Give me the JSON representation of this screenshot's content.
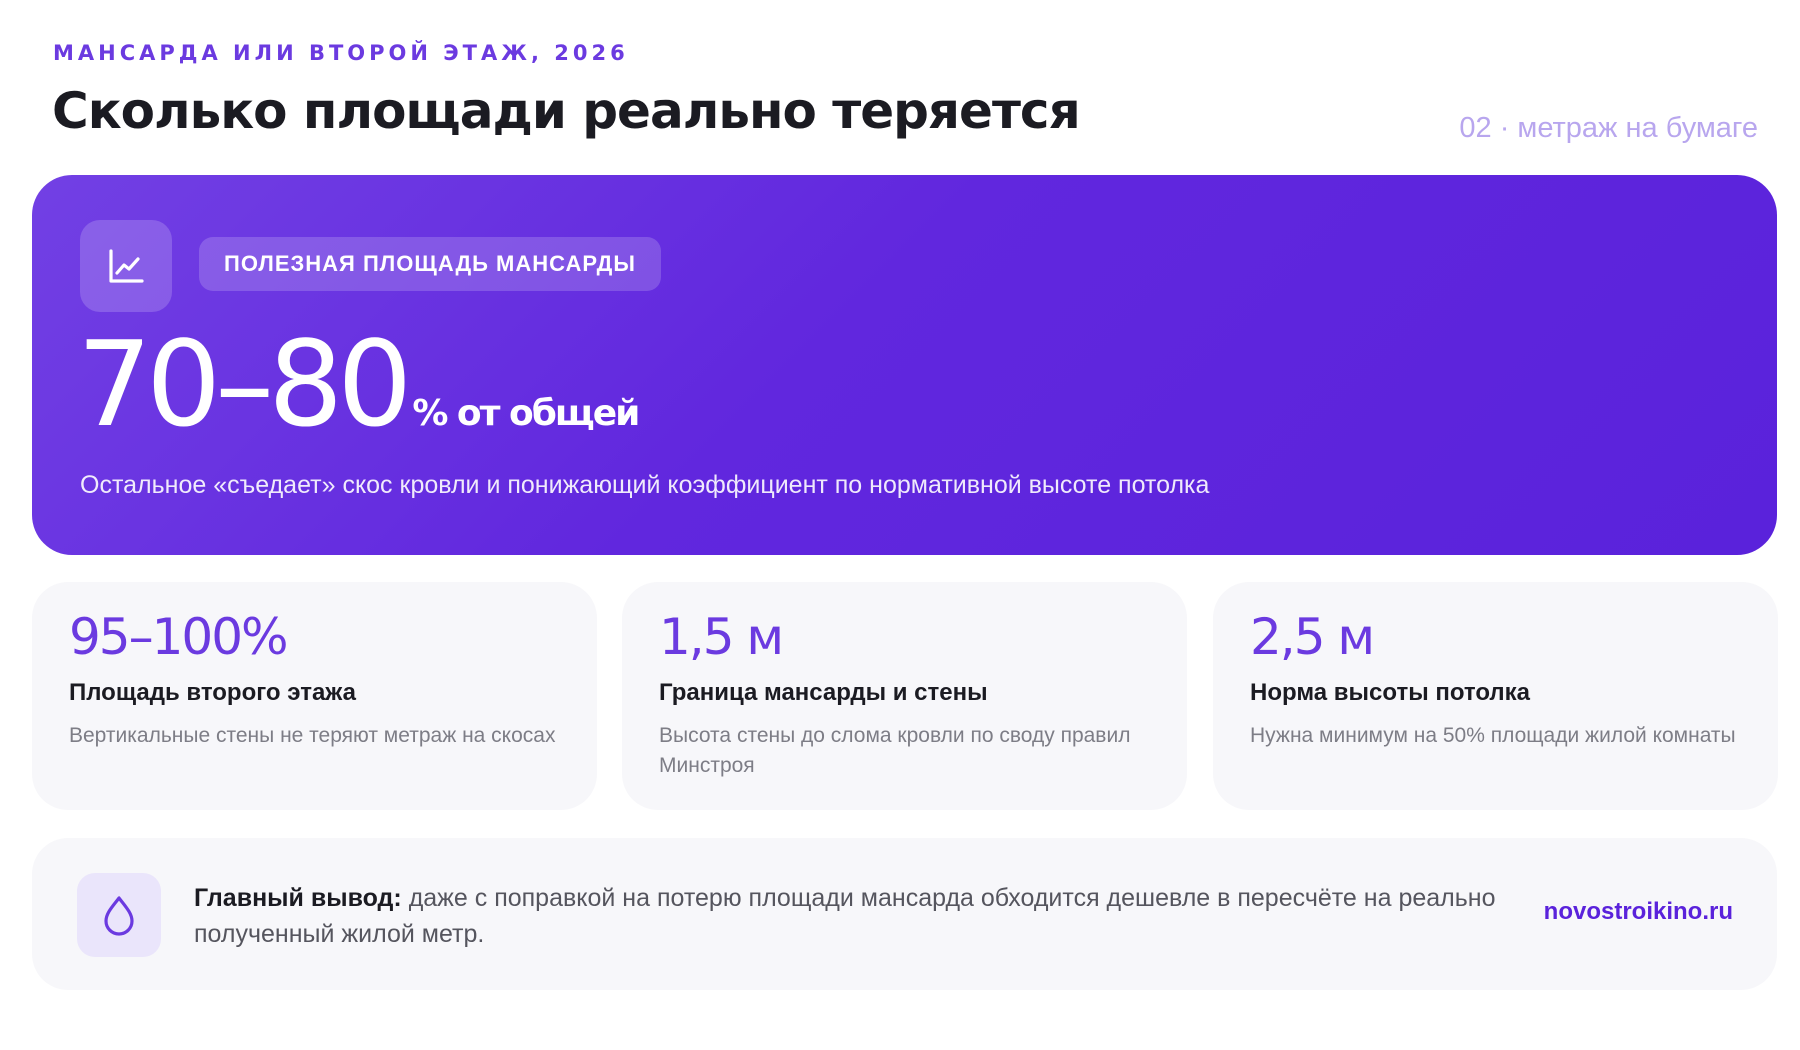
{
  "header": {
    "eyebrow": "МАНСАРДА ИЛИ ВТОРОЙ ЭТАЖ, 2026",
    "title": "Сколько площади реально теряется",
    "tag": "02 · метраж на бумаге"
  },
  "hero": {
    "icon": "chart-line-icon",
    "label": "ПОЛЕЗНАЯ ПЛОЩАДЬ МАНСАРДЫ",
    "value": "70–80",
    "unit": "% от общей",
    "caption": "Остальное «съедает» скос кровли и понижающий коэффициент по нормативной высоте потолка"
  },
  "stats": [
    {
      "value": "95–100%",
      "heading": "Площадь второго этажа",
      "desc": "Вертикальные стены не теряют метраж на скосах"
    },
    {
      "value": "1,5 м",
      "heading": "Граница мансарды и стены",
      "desc": "Высота стены до слома кровли по своду правил Минстроя"
    },
    {
      "value": "2,5 м",
      "heading": "Норма высоты потолка",
      "desc": "Нужна минимум на 50% площади жилой комнаты"
    }
  ],
  "conclusion": {
    "icon": "droplet-icon",
    "lead": "Главный вывод:",
    "text": " даже с поправкой на потерю площади мансарда обходится дешевле в пересчёте на реально полученный жилой метр.",
    "site": "novostroikino.ru"
  },
  "colors": {
    "accent": "#6b3ae0",
    "hero_start": "#7240e4",
    "hero_end": "#5a22db",
    "card_bg": "#f7f7fa"
  }
}
